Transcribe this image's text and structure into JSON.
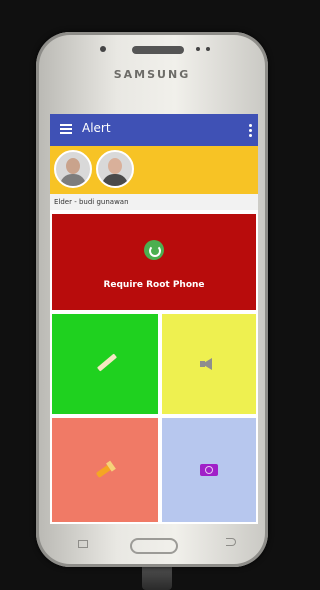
{
  "device": {
    "brand": "SAMSUNG"
  },
  "appbar": {
    "title": "Alert",
    "menu_icon": "hamburger-menu-icon",
    "overflow_icon": "overflow-menu-icon"
  },
  "contacts": [
    {
      "name": "contact-1"
    },
    {
      "name": "contact-2"
    }
  ],
  "elder_label": "Elder - budi gunawan",
  "root_panel": {
    "label": "Require Root Phone",
    "icon": "refresh-icon"
  },
  "tiles": [
    {
      "name": "tile-edit",
      "icon": "pencil-icon"
    },
    {
      "name": "tile-sound",
      "icon": "speaker-icon"
    },
    {
      "name": "tile-flashlight",
      "icon": "flashlight-icon"
    },
    {
      "name": "tile-camera",
      "icon": "camera-icon"
    }
  ]
}
